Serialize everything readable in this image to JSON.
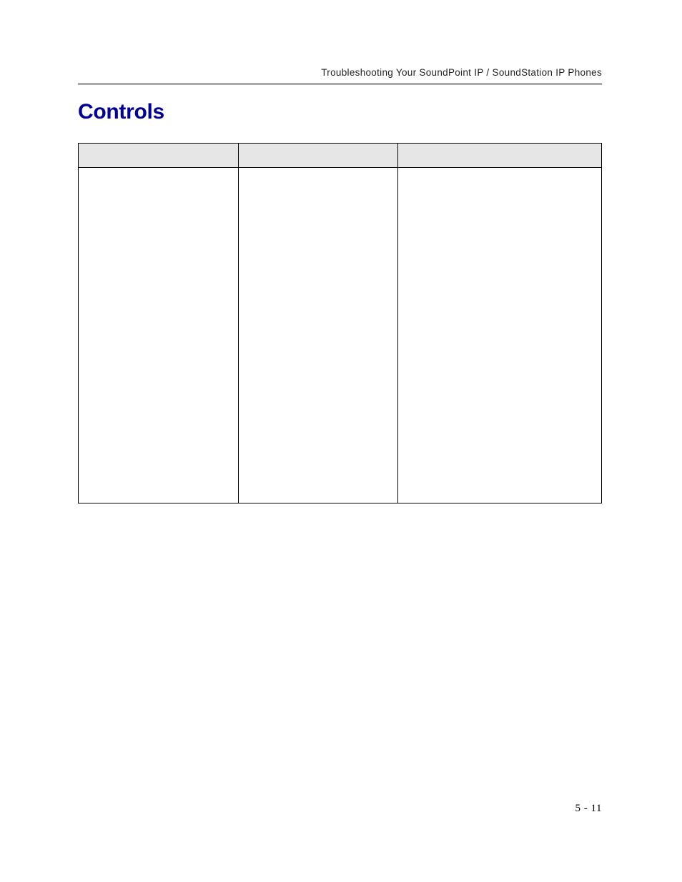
{
  "header": {
    "running_title": "Troubleshooting Your SoundPoint IP / SoundStation IP Phones"
  },
  "section": {
    "title": "Controls"
  },
  "table": {
    "headers": [
      "",
      "",
      ""
    ],
    "body": [
      [
        "",
        "",
        ""
      ]
    ]
  },
  "footer": {
    "page_number": "5 - 11"
  }
}
